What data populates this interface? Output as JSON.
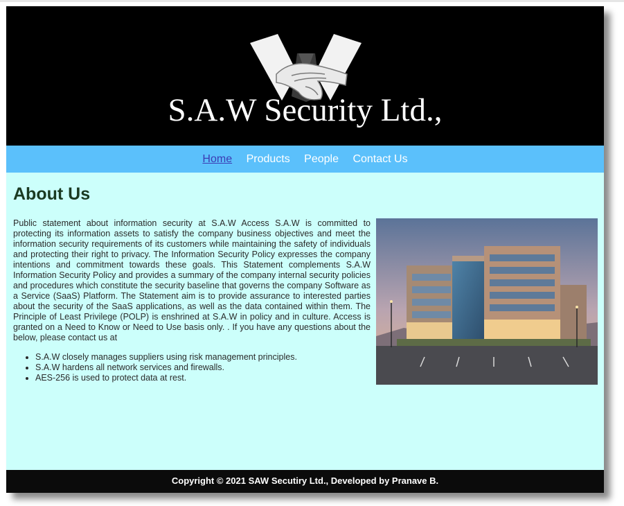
{
  "header": {
    "title": "S.A.W Security Ltd.,",
    "logo_icon": "tie-handshake-logo-icon"
  },
  "nav": {
    "items": [
      {
        "label": "Home",
        "active": true
      },
      {
        "label": "Products",
        "active": false
      },
      {
        "label": "People",
        "active": false
      },
      {
        "label": "Contact Us",
        "active": false
      }
    ]
  },
  "main": {
    "heading": "About Us",
    "paragraph": "Public statement about information security at S.A.W Access S.A.W is committed to protecting its information assets to satisfy the company business objectives and meet the information security requirements of its customers while maintaining the safety of individuals and protecting their right to privacy. The Information Security Policy expresses the company intentions and commitment towards these goals. This Statement complements S.A.W Information Security Policy and provides a summary of the company internal security policies and procedures which constitute the security baseline that governs the company Software as a Service (SaaS) Platform. The Statement aim is to provide assurance to interested parties about the security of the SaaS applications, as well as the data contained within them. The Principle of Least Privilege (POLP) is enshrined at S.A.W in policy and in culture. Access is granted on a Need to Know or Need to Use basis only. . If you have any questions about the below, please contact us at",
    "bullets": [
      "S.A.W closely manages suppliers using risk management principles.",
      "S.A.W hardens all network services and firewalls.",
      "AES-256 is used to protect data at rest."
    ],
    "image_icon": "office-building-photo"
  },
  "footer": {
    "copyright": "Copyright © 2021 SAW Secutiry Ltd., Developed by Pranave B."
  },
  "colors": {
    "header_bg": "#000000",
    "nav_bg": "#5bc0fb",
    "page_bg": "#ccfffb",
    "heading": "#1a3a22",
    "active_link": "#3b3bb3",
    "footer_bg": "#0b0b0b"
  }
}
